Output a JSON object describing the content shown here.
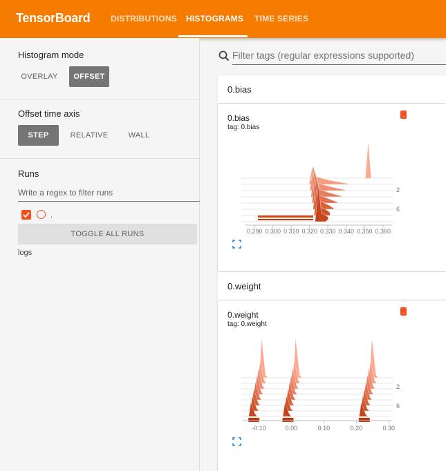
{
  "header": {
    "brand": "TensorBoard",
    "tabs": [
      {
        "label": "DISTRIBUTIONS",
        "active": false
      },
      {
        "label": "HISTOGRAMS",
        "active": true
      },
      {
        "label": "TIME SERIES",
        "active": false
      }
    ],
    "color": "#f57c00"
  },
  "sidebar": {
    "histogram_mode": {
      "title": "Histogram mode",
      "options": [
        "OVERLAY",
        "OFFSET"
      ],
      "selected": "OFFSET"
    },
    "offset_axis": {
      "title": "Offset time axis",
      "options": [
        "STEP",
        "RELATIVE",
        "WALL"
      ],
      "selected": "STEP"
    },
    "runs": {
      "title": "Runs",
      "filter_placeholder": "Write a regex to filter runs",
      "run_label": ".",
      "toggle_label": "TOGGLE ALL RUNS",
      "logdir": "logs"
    }
  },
  "main": {
    "filter_placeholder": "Filter tags (regular expressions supported)",
    "groups": [
      {
        "name": "0.bias",
        "card": {
          "title": "0.bias",
          "tag": "tag: 0.bias"
        }
      },
      {
        "name": "0.weight",
        "card": {
          "title": "0.weight",
          "tag": "tag: 0.weight"
        }
      }
    ]
  },
  "chart_data": [
    {
      "type": "histogram-offset",
      "series_name": "0.bias",
      "x_ticks": [
        "0.290",
        "0.300",
        "0.310",
        "0.320",
        "0.330",
        "0.340",
        "0.350",
        "0.360"
      ],
      "y_ticks": [
        "2",
        "6"
      ],
      "xlim": [
        0.285,
        0.365
      ],
      "peaks": [
        {
          "step": 0,
          "x": 0.352,
          "height": 1.0
        },
        {
          "step": 1,
          "x": 0.3215,
          "height": 0.25
        },
        {
          "step": 2,
          "x": 0.3215,
          "height": 0.5
        },
        {
          "step": 3,
          "x": 0.3215,
          "height": 0.6
        },
        {
          "step": 4,
          "x": 0.3215,
          "height": 0.7
        },
        {
          "step": 5,
          "x": 0.3215,
          "height": 0.8
        },
        {
          "step": 6,
          "x": 0.3215,
          "height": 0.85
        },
        {
          "step": 7,
          "x": 0.3215,
          "height": 0.9
        }
      ]
    },
    {
      "type": "histogram-offset",
      "series_name": "0.weight",
      "x_ticks": [
        "-0.10",
        "0.00",
        "0.10",
        "0.20",
        "0.30"
      ],
      "y_ticks": [
        "2",
        "6"
      ],
      "xlim": [
        -0.15,
        0.31
      ],
      "clusters": [
        -0.09,
        0.015,
        0.25
      ]
    }
  ]
}
